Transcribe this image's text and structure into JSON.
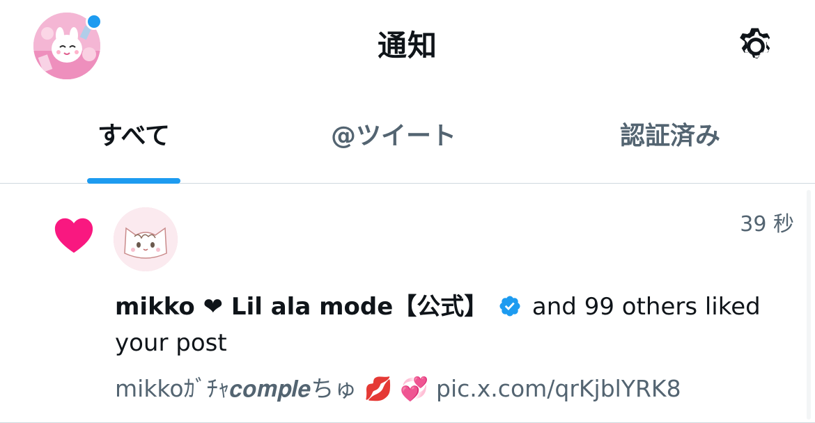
{
  "header": {
    "title": "通知",
    "avatar_icon": "profile-avatar",
    "settings_icon": "gear-icon",
    "notification_dot_color": "#1d9bf0"
  },
  "tabs": [
    {
      "label": "すべて",
      "active": true
    },
    {
      "label": "@ツイート",
      "active": false
    },
    {
      "label": "認証済み",
      "active": false
    }
  ],
  "notification": {
    "type_icon": "heart-icon",
    "type_color": "#f91880",
    "timestamp": "39 秒",
    "user_name": "mikko ❤ Lil ala mode【公式】",
    "verified": true,
    "action_text": " and 99 others liked your post",
    "preview_text": "mikkoｶﾞﾁｬ𝒄𝒐𝒎𝒑𝒍𝒆ちゅ 💋 💞  ",
    "preview_link": "pic.x.com/qrKjblYRK8"
  },
  "colors": {
    "accent": "#1d9bf0",
    "text_primary": "#0f1419",
    "text_secondary": "#536471",
    "divider": "#cfd9de"
  }
}
